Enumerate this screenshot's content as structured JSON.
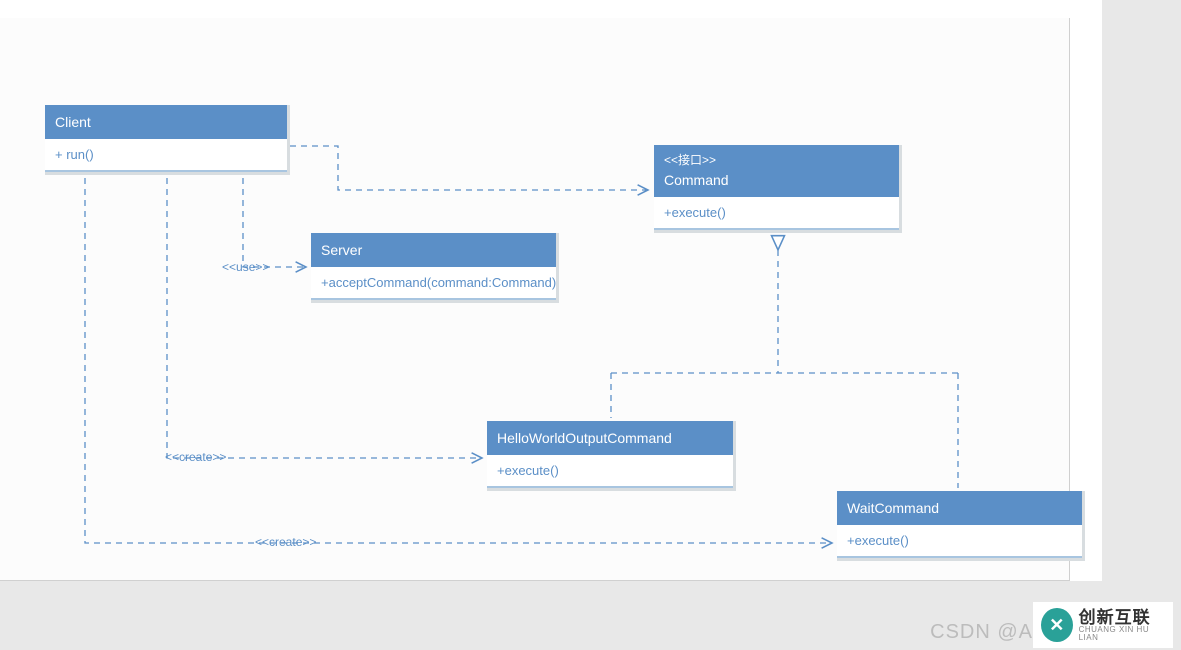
{
  "diagram": {
    "client": {
      "title": "Client",
      "methods": [
        "+ run()"
      ]
    },
    "server": {
      "title": "Server",
      "methods": [
        "+acceptCommand(command:Command)"
      ]
    },
    "command": {
      "stereotype": "<<接口>>",
      "title": "Command",
      "methods": [
        "+execute()"
      ]
    },
    "hello": {
      "title": "HelloWorldOutputCommand",
      "methods": [
        "+execute()"
      ]
    },
    "wait": {
      "title": "WaitCommand",
      "methods": [
        "+execute()"
      ]
    },
    "relations": {
      "client_server_label": "<<use>>",
      "client_hello_label": "<<create>>",
      "client_wait_label": "<<create>>"
    }
  },
  "watermark": "CSDN @A",
  "brand": {
    "zh": "创新互联",
    "en": "CHUANG XIN HU LIAN",
    "glyph": "✕"
  }
}
